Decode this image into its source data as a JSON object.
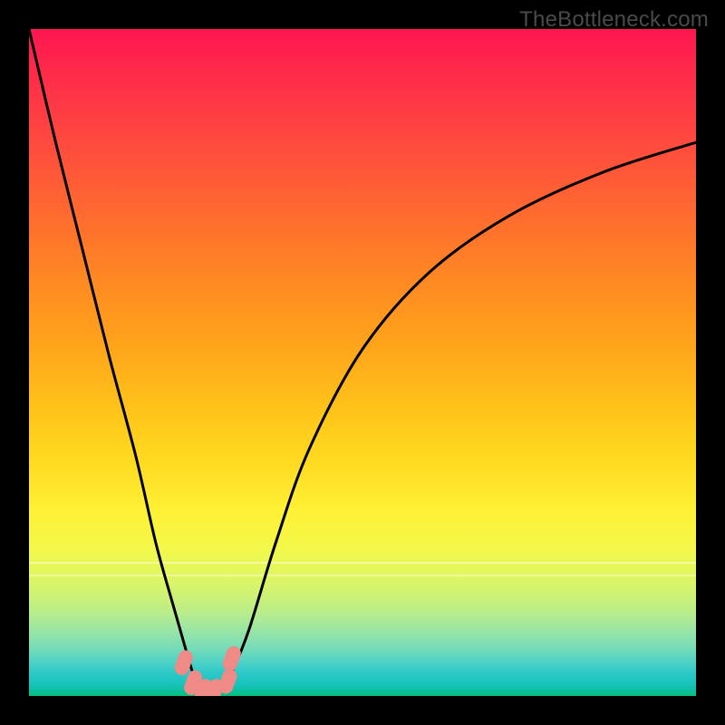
{
  "watermark": "TheBottleneck.com",
  "colors": {
    "frame": "#000000",
    "curve": "#000000",
    "marker": "#ef8a86"
  },
  "chart_data": {
    "type": "line",
    "title": "",
    "xlabel": "",
    "ylabel": "",
    "xlim": [
      0,
      100
    ],
    "ylim": [
      0,
      100
    ],
    "grid": false,
    "legend": false,
    "series": [
      {
        "name": "bottleneck-curve",
        "x": [
          0,
          4,
          8,
          12,
          16,
          19,
          21.5,
          23.5,
          25,
          26.2,
          27.2,
          28,
          29,
          30.5,
          33,
          37,
          42,
          50,
          60,
          72,
          86,
          100
        ],
        "y": [
          100,
          83,
          67,
          51,
          36,
          23,
          14,
          7,
          2.2,
          0.7,
          0.4,
          0.6,
          1.4,
          3.8,
          10,
          23,
          37,
          52,
          63.5,
          72,
          78.5,
          83
        ]
      }
    ],
    "markers": [
      {
        "x": 23.2,
        "y": 5.0
      },
      {
        "x": 24.6,
        "y": 2.0
      },
      {
        "x": 26.2,
        "y": 0.7
      },
      {
        "x": 27.8,
        "y": 0.7
      },
      {
        "x": 29.8,
        "y": 2.2
      },
      {
        "x": 30.4,
        "y": 5.6
      }
    ]
  }
}
